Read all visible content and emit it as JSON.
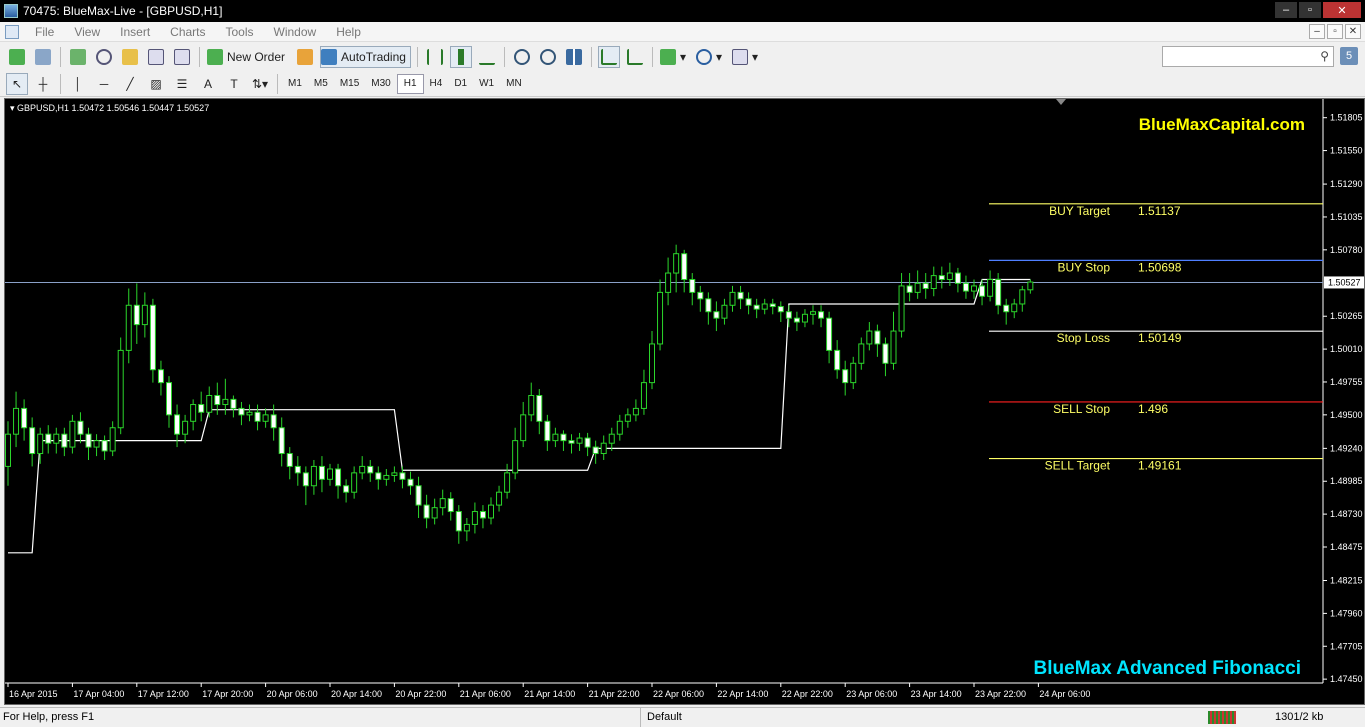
{
  "window": {
    "title": "70475: BlueMax-Live - [GBPUSD,H1]",
    "controls": [
      "–",
      "▫",
      "✕"
    ]
  },
  "menu": [
    "File",
    "View",
    "Insert",
    "Charts",
    "Tools",
    "Window",
    "Help"
  ],
  "toolbar": {
    "new_order_label": "New Order",
    "autotrading_label": "AutoTrading"
  },
  "timeframes": [
    "M1",
    "M5",
    "M15",
    "M30",
    "H1",
    "H4",
    "D1",
    "W1",
    "MN"
  ],
  "active_timeframe": "H1",
  "search": {
    "placeholder": ""
  },
  "help_button": "5",
  "chart_data": {
    "type": "candlestick",
    "symbol": "GBPUSD,H1",
    "header": "GBPUSD,H1  1.50472 1.50546 1.50447 1.50527",
    "current_price": 1.50527,
    "current_price_label": "1.50527",
    "ylim": [
      1.4742,
      1.5195
    ],
    "yticks": [
      1.51805,
      1.5155,
      1.5129,
      1.51035,
      1.5078,
      1.50265,
      1.5001,
      1.49755,
      1.495,
      1.4924,
      1.48985,
      1.4873,
      1.48475,
      1.48215,
      1.4796,
      1.47705,
      1.4745
    ],
    "ytick_labels": [
      "1.51805",
      "1.51550",
      "1.51290",
      "1.51035",
      "1.50780",
      "1.50265",
      "1.50010",
      "1.49755",
      "1.49500",
      "1.49240",
      "1.48985",
      "1.48730",
      "1.48475",
      "1.48215",
      "1.47960",
      "1.47705",
      "1.47450"
    ],
    "xtick_labels": [
      "16 Apr 2015",
      "17 Apr 04:00",
      "17 Apr 12:00",
      "17 Apr 20:00",
      "20 Apr 06:00",
      "20 Apr 14:00",
      "20 Apr 22:00",
      "21 Apr 06:00",
      "21 Apr 14:00",
      "21 Apr 22:00",
      "22 Apr 06:00",
      "22 Apr 14:00",
      "22 Apr 22:00",
      "23 Apr 06:00",
      "23 Apr 14:00",
      "23 Apr 22:00",
      "24 Apr 06:00"
    ],
    "levels": [
      {
        "label": "BUY Target",
        "value_label": "1.51137",
        "price": 1.51137,
        "color": "#ffff66"
      },
      {
        "label": "BUY Stop",
        "value_label": "1.50698",
        "price": 1.50698,
        "color": "#4f7fff"
      },
      {
        "label": "Stop Loss",
        "value_label": "1.50149",
        "price": 1.50149,
        "color": "#ffffff"
      },
      {
        "label": "SELL Stop",
        "value_label": "1.496",
        "price": 1.496,
        "color": "#ff2020"
      },
      {
        "label": "SELL Target",
        "value_label": "1.49161",
        "price": 1.49161,
        "color": "#ffff66"
      }
    ],
    "step_line": [
      [
        0,
        1.4843
      ],
      [
        3,
        1.4843
      ],
      [
        4,
        1.493
      ],
      [
        24,
        1.493
      ],
      [
        25,
        1.4954
      ],
      [
        48,
        1.4954
      ],
      [
        49,
        1.4907
      ],
      [
        72,
        1.4907
      ],
      [
        73,
        1.4924
      ],
      [
        96,
        1.4924
      ],
      [
        97,
        1.5036
      ],
      [
        120,
        1.5036
      ],
      [
        121,
        1.5055
      ],
      [
        127,
        1.5055
      ]
    ],
    "candles": [
      [
        1.491,
        1.4935,
        1.4895,
        1.4945
      ],
      [
        1.4935,
        1.4955,
        1.4925,
        1.4968
      ],
      [
        1.4955,
        1.494,
        1.493,
        1.4962
      ],
      [
        1.494,
        1.492,
        1.491,
        1.4948
      ],
      [
        1.492,
        1.4935,
        1.4912,
        1.494
      ],
      [
        1.4935,
        1.4928,
        1.492,
        1.4942
      ],
      [
        1.4928,
        1.4935,
        1.492,
        1.494
      ],
      [
        1.4935,
        1.4925,
        1.4918,
        1.494
      ],
      [
        1.4925,
        1.4945,
        1.492,
        1.495
      ],
      [
        1.4945,
        1.4935,
        1.4928,
        1.4952
      ],
      [
        1.4935,
        1.4925,
        1.4915,
        1.494
      ],
      [
        1.4925,
        1.493,
        1.4918,
        1.4935
      ],
      [
        1.493,
        1.4922,
        1.4915,
        1.4934
      ],
      [
        1.4922,
        1.494,
        1.4918,
        1.4945
      ],
      [
        1.494,
        1.5,
        1.4935,
        1.501
      ],
      [
        1.5,
        1.5035,
        1.499,
        1.5048
      ],
      [
        1.5035,
        1.502,
        1.5005,
        1.5052
      ],
      [
        1.502,
        1.5035,
        1.501,
        1.5045
      ],
      [
        1.5035,
        1.4985,
        1.4975,
        1.504
      ],
      [
        1.4985,
        1.4975,
        1.4965,
        1.4992
      ],
      [
        1.4975,
        1.495,
        1.494,
        1.498
      ],
      [
        1.495,
        1.4935,
        1.4925,
        1.4958
      ],
      [
        1.4935,
        1.4945,
        1.4928,
        1.495
      ],
      [
        1.4945,
        1.4958,
        1.4938,
        1.4962
      ],
      [
        1.4958,
        1.4952,
        1.4945,
        1.4968
      ],
      [
        1.4952,
        1.4965,
        1.4948,
        1.4972
      ],
      [
        1.4965,
        1.4958,
        1.495,
        1.4975
      ],
      [
        1.4958,
        1.4962,
        1.495,
        1.4978
      ],
      [
        1.4962,
        1.4955,
        1.4948,
        1.4965
      ],
      [
        1.4955,
        1.495,
        1.4942,
        1.496
      ],
      [
        1.495,
        1.4952,
        1.4945,
        1.4958
      ],
      [
        1.4952,
        1.4945,
        1.4938,
        1.4958
      ],
      [
        1.4945,
        1.495,
        1.494,
        1.4955
      ],
      [
        1.495,
        1.494,
        1.493,
        1.4958
      ],
      [
        1.494,
        1.492,
        1.491,
        1.4948
      ],
      [
        1.492,
        1.491,
        1.49,
        1.4925
      ],
      [
        1.491,
        1.4905,
        1.4895,
        1.4918
      ],
      [
        1.4905,
        1.4895,
        1.488,
        1.491
      ],
      [
        1.4895,
        1.491,
        1.4888,
        1.4915
      ],
      [
        1.491,
        1.49,
        1.489,
        1.4918
      ],
      [
        1.49,
        1.4908,
        1.4895,
        1.4912
      ],
      [
        1.4908,
        1.4895,
        1.4885,
        1.4912
      ],
      [
        1.4895,
        1.489,
        1.4882,
        1.49
      ],
      [
        1.489,
        1.4905,
        1.4885,
        1.491
      ],
      [
        1.4905,
        1.491,
        1.49,
        1.4918
      ],
      [
        1.491,
        1.4905,
        1.4898,
        1.4915
      ],
      [
        1.4905,
        1.49,
        1.4892,
        1.491
      ],
      [
        1.49,
        1.4903,
        1.4895,
        1.4908
      ],
      [
        1.4903,
        1.4905,
        1.4898,
        1.491
      ],
      [
        1.4905,
        1.49,
        1.4893,
        1.491
      ],
      [
        1.49,
        1.4895,
        1.4888,
        1.4906
      ],
      [
        1.4895,
        1.488,
        1.487,
        1.4902
      ],
      [
        1.488,
        1.487,
        1.4862,
        1.4888
      ],
      [
        1.487,
        1.4878,
        1.4865,
        1.4885
      ],
      [
        1.4878,
        1.4885,
        1.4872,
        1.4892
      ],
      [
        1.4885,
        1.4875,
        1.4868,
        1.489
      ],
      [
        1.4875,
        1.486,
        1.485,
        1.488
      ],
      [
        1.486,
        1.4865,
        1.4852,
        1.487
      ],
      [
        1.4865,
        1.4875,
        1.4858,
        1.4882
      ],
      [
        1.4875,
        1.487,
        1.4862,
        1.488
      ],
      [
        1.487,
        1.488,
        1.4865,
        1.4886
      ],
      [
        1.488,
        1.489,
        1.4875,
        1.4895
      ],
      [
        1.489,
        1.4905,
        1.4885,
        1.4912
      ],
      [
        1.4905,
        1.493,
        1.49,
        1.494
      ],
      [
        1.493,
        1.495,
        1.4925,
        1.496
      ],
      [
        1.495,
        1.4965,
        1.4945,
        1.4975
      ],
      [
        1.4965,
        1.4945,
        1.4935,
        1.497
      ],
      [
        1.4945,
        1.493,
        1.4922,
        1.495
      ],
      [
        1.493,
        1.4935,
        1.4925,
        1.494
      ],
      [
        1.4935,
        1.493,
        1.4922,
        1.4938
      ],
      [
        1.493,
        1.4928,
        1.492,
        1.4935
      ],
      [
        1.4928,
        1.4932,
        1.4922,
        1.4936
      ],
      [
        1.4932,
        1.4925,
        1.4918,
        1.4936
      ],
      [
        1.4925,
        1.492,
        1.4912,
        1.493
      ],
      [
        1.492,
        1.4928,
        1.4915,
        1.4934
      ],
      [
        1.4928,
        1.4935,
        1.4922,
        1.494
      ],
      [
        1.4935,
        1.4945,
        1.493,
        1.495
      ],
      [
        1.4945,
        1.495,
        1.494,
        1.4955
      ],
      [
        1.495,
        1.4955,
        1.4945,
        1.4962
      ],
      [
        1.4955,
        1.4975,
        1.495,
        1.4985
      ],
      [
        1.4975,
        1.5005,
        1.497,
        1.5015
      ],
      [
        1.5005,
        1.5045,
        1.5,
        1.5055
      ],
      [
        1.5045,
        1.506,
        1.5035,
        1.5072
      ],
      [
        1.506,
        1.5075,
        1.5045,
        1.5082
      ],
      [
        1.5075,
        1.5055,
        1.5045,
        1.5078
      ],
      [
        1.5055,
        1.5045,
        1.5035,
        1.506
      ],
      [
        1.5045,
        1.504,
        1.503,
        1.505
      ],
      [
        1.504,
        1.503,
        1.502,
        1.5045
      ],
      [
        1.503,
        1.5025,
        1.5015,
        1.5038
      ],
      [
        1.5025,
        1.5035,
        1.502,
        1.504
      ],
      [
        1.5035,
        1.5045,
        1.503,
        1.505
      ],
      [
        1.5045,
        1.504,
        1.5032,
        1.505
      ],
      [
        1.504,
        1.5035,
        1.5028,
        1.5045
      ],
      [
        1.5035,
        1.5032,
        1.5025,
        1.504
      ],
      [
        1.5032,
        1.5036,
        1.5028,
        1.504
      ],
      [
        1.5036,
        1.5034,
        1.5028,
        1.504
      ],
      [
        1.5034,
        1.503,
        1.5022,
        1.5038
      ],
      [
        1.503,
        1.5025,
        1.5018,
        1.5035
      ],
      [
        1.5025,
        1.5022,
        1.5015,
        1.503
      ],
      [
        1.5022,
        1.5028,
        1.5018,
        1.5032
      ],
      [
        1.5028,
        1.503,
        1.502,
        1.5035
      ],
      [
        1.503,
        1.5025,
        1.5018,
        1.5035
      ],
      [
        1.5025,
        1.5,
        1.499,
        1.503
      ],
      [
        1.5,
        1.4985,
        1.4978,
        1.5008
      ],
      [
        1.4985,
        1.4975,
        1.4965,
        1.4992
      ],
      [
        1.4975,
        1.499,
        1.497,
        1.4995
      ],
      [
        1.499,
        1.5005,
        1.4985,
        1.501
      ],
      [
        1.5005,
        1.5015,
        1.5,
        1.5022
      ],
      [
        1.5015,
        1.5005,
        1.4995,
        1.502
      ],
      [
        1.5005,
        1.499,
        1.498,
        1.501
      ],
      [
        1.499,
        1.5015,
        1.4985,
        1.503
      ],
      [
        1.5015,
        1.505,
        1.501,
        1.506
      ],
      [
        1.505,
        1.5045,
        1.5038,
        1.506
      ],
      [
        1.5045,
        1.5052,
        1.504,
        1.5062
      ],
      [
        1.5052,
        1.5048,
        1.504,
        1.506
      ],
      [
        1.5048,
        1.5058,
        1.5042,
        1.5065
      ],
      [
        1.5058,
        1.5055,
        1.5048,
        1.5065
      ],
      [
        1.5055,
        1.506,
        1.505,
        1.5068
      ],
      [
        1.506,
        1.5052,
        1.5045,
        1.5064
      ],
      [
        1.5052,
        1.5046,
        1.504,
        1.5058
      ],
      [
        1.5046,
        1.505,
        1.504,
        1.5055
      ],
      [
        1.505,
        1.5042,
        1.5035,
        1.5055
      ],
      [
        1.5042,
        1.5055,
        1.5038,
        1.5062
      ],
      [
        1.5055,
        1.5035,
        1.5028,
        1.506
      ],
      [
        1.5035,
        1.503,
        1.502,
        1.504
      ],
      [
        1.503,
        1.5036,
        1.5025,
        1.504
      ],
      [
        1.5036,
        1.5047,
        1.503,
        1.505
      ],
      [
        1.5047,
        1.5053,
        1.5044,
        1.5055
      ]
    ]
  },
  "overlays": {
    "brand_top": "BlueMaxCapital.com",
    "brand_bottom": "BlueMax Advanced Fibonacci"
  },
  "status": {
    "help": "For Help, press F1",
    "profile": "Default",
    "traffic": "1301/2 kb"
  }
}
